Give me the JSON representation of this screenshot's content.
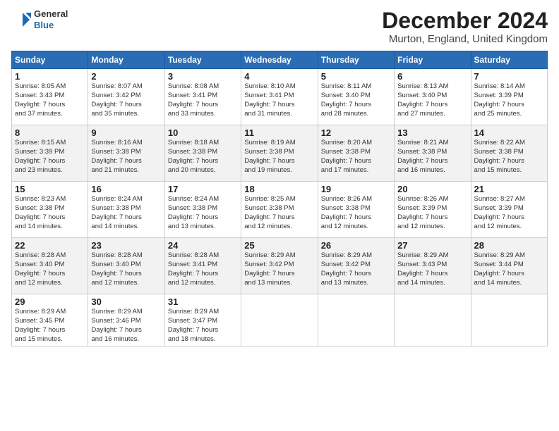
{
  "logo": {
    "line1": "General",
    "line2": "Blue"
  },
  "title": "December 2024",
  "location": "Murton, England, United Kingdom",
  "days_of_week": [
    "Sunday",
    "Monday",
    "Tuesday",
    "Wednesday",
    "Thursday",
    "Friday",
    "Saturday"
  ],
  "weeks": [
    [
      {
        "day": 1,
        "lines": [
          "Sunrise: 8:05 AM",
          "Sunset: 3:43 PM",
          "Daylight: 7 hours",
          "and 37 minutes."
        ]
      },
      {
        "day": 2,
        "lines": [
          "Sunrise: 8:07 AM",
          "Sunset: 3:42 PM",
          "Daylight: 7 hours",
          "and 35 minutes."
        ]
      },
      {
        "day": 3,
        "lines": [
          "Sunrise: 8:08 AM",
          "Sunset: 3:41 PM",
          "Daylight: 7 hours",
          "and 33 minutes."
        ]
      },
      {
        "day": 4,
        "lines": [
          "Sunrise: 8:10 AM",
          "Sunset: 3:41 PM",
          "Daylight: 7 hours",
          "and 31 minutes."
        ]
      },
      {
        "day": 5,
        "lines": [
          "Sunrise: 8:11 AM",
          "Sunset: 3:40 PM",
          "Daylight: 7 hours",
          "and 28 minutes."
        ]
      },
      {
        "day": 6,
        "lines": [
          "Sunrise: 8:13 AM",
          "Sunset: 3:40 PM",
          "Daylight: 7 hours",
          "and 27 minutes."
        ]
      },
      {
        "day": 7,
        "lines": [
          "Sunrise: 8:14 AM",
          "Sunset: 3:39 PM",
          "Daylight: 7 hours",
          "and 25 minutes."
        ]
      }
    ],
    [
      {
        "day": 8,
        "lines": [
          "Sunrise: 8:15 AM",
          "Sunset: 3:39 PM",
          "Daylight: 7 hours",
          "and 23 minutes."
        ]
      },
      {
        "day": 9,
        "lines": [
          "Sunrise: 8:16 AM",
          "Sunset: 3:38 PM",
          "Daylight: 7 hours",
          "and 21 minutes."
        ]
      },
      {
        "day": 10,
        "lines": [
          "Sunrise: 8:18 AM",
          "Sunset: 3:38 PM",
          "Daylight: 7 hours",
          "and 20 minutes."
        ]
      },
      {
        "day": 11,
        "lines": [
          "Sunrise: 8:19 AM",
          "Sunset: 3:38 PM",
          "Daylight: 7 hours",
          "and 19 minutes."
        ]
      },
      {
        "day": 12,
        "lines": [
          "Sunrise: 8:20 AM",
          "Sunset: 3:38 PM",
          "Daylight: 7 hours",
          "and 17 minutes."
        ]
      },
      {
        "day": 13,
        "lines": [
          "Sunrise: 8:21 AM",
          "Sunset: 3:38 PM",
          "Daylight: 7 hours",
          "and 16 minutes."
        ]
      },
      {
        "day": 14,
        "lines": [
          "Sunrise: 8:22 AM",
          "Sunset: 3:38 PM",
          "Daylight: 7 hours",
          "and 15 minutes."
        ]
      }
    ],
    [
      {
        "day": 15,
        "lines": [
          "Sunrise: 8:23 AM",
          "Sunset: 3:38 PM",
          "Daylight: 7 hours",
          "and 14 minutes."
        ]
      },
      {
        "day": 16,
        "lines": [
          "Sunrise: 8:24 AM",
          "Sunset: 3:38 PM",
          "Daylight: 7 hours",
          "and 14 minutes."
        ]
      },
      {
        "day": 17,
        "lines": [
          "Sunrise: 8:24 AM",
          "Sunset: 3:38 PM",
          "Daylight: 7 hours",
          "and 13 minutes."
        ]
      },
      {
        "day": 18,
        "lines": [
          "Sunrise: 8:25 AM",
          "Sunset: 3:38 PM",
          "Daylight: 7 hours",
          "and 12 minutes."
        ]
      },
      {
        "day": 19,
        "lines": [
          "Sunrise: 8:26 AM",
          "Sunset: 3:38 PM",
          "Daylight: 7 hours",
          "and 12 minutes."
        ]
      },
      {
        "day": 20,
        "lines": [
          "Sunrise: 8:26 AM",
          "Sunset: 3:39 PM",
          "Daylight: 7 hours",
          "and 12 minutes."
        ]
      },
      {
        "day": 21,
        "lines": [
          "Sunrise: 8:27 AM",
          "Sunset: 3:39 PM",
          "Daylight: 7 hours",
          "and 12 minutes."
        ]
      }
    ],
    [
      {
        "day": 22,
        "lines": [
          "Sunrise: 8:28 AM",
          "Sunset: 3:40 PM",
          "Daylight: 7 hours",
          "and 12 minutes."
        ]
      },
      {
        "day": 23,
        "lines": [
          "Sunrise: 8:28 AM",
          "Sunset: 3:40 PM",
          "Daylight: 7 hours",
          "and 12 minutes."
        ]
      },
      {
        "day": 24,
        "lines": [
          "Sunrise: 8:28 AM",
          "Sunset: 3:41 PM",
          "Daylight: 7 hours",
          "and 12 minutes."
        ]
      },
      {
        "day": 25,
        "lines": [
          "Sunrise: 8:29 AM",
          "Sunset: 3:42 PM",
          "Daylight: 7 hours",
          "and 13 minutes."
        ]
      },
      {
        "day": 26,
        "lines": [
          "Sunrise: 8:29 AM",
          "Sunset: 3:42 PM",
          "Daylight: 7 hours",
          "and 13 minutes."
        ]
      },
      {
        "day": 27,
        "lines": [
          "Sunrise: 8:29 AM",
          "Sunset: 3:43 PM",
          "Daylight: 7 hours",
          "and 14 minutes."
        ]
      },
      {
        "day": 28,
        "lines": [
          "Sunrise: 8:29 AM",
          "Sunset: 3:44 PM",
          "Daylight: 7 hours",
          "and 14 minutes."
        ]
      }
    ],
    [
      {
        "day": 29,
        "lines": [
          "Sunrise: 8:29 AM",
          "Sunset: 3:45 PM",
          "Daylight: 7 hours",
          "and 15 minutes."
        ]
      },
      {
        "day": 30,
        "lines": [
          "Sunrise: 8:29 AM",
          "Sunset: 3:46 PM",
          "Daylight: 7 hours",
          "and 16 minutes."
        ]
      },
      {
        "day": 31,
        "lines": [
          "Sunrise: 8:29 AM",
          "Sunset: 3:47 PM",
          "Daylight: 7 hours",
          "and 18 minutes."
        ]
      },
      null,
      null,
      null,
      null
    ]
  ]
}
